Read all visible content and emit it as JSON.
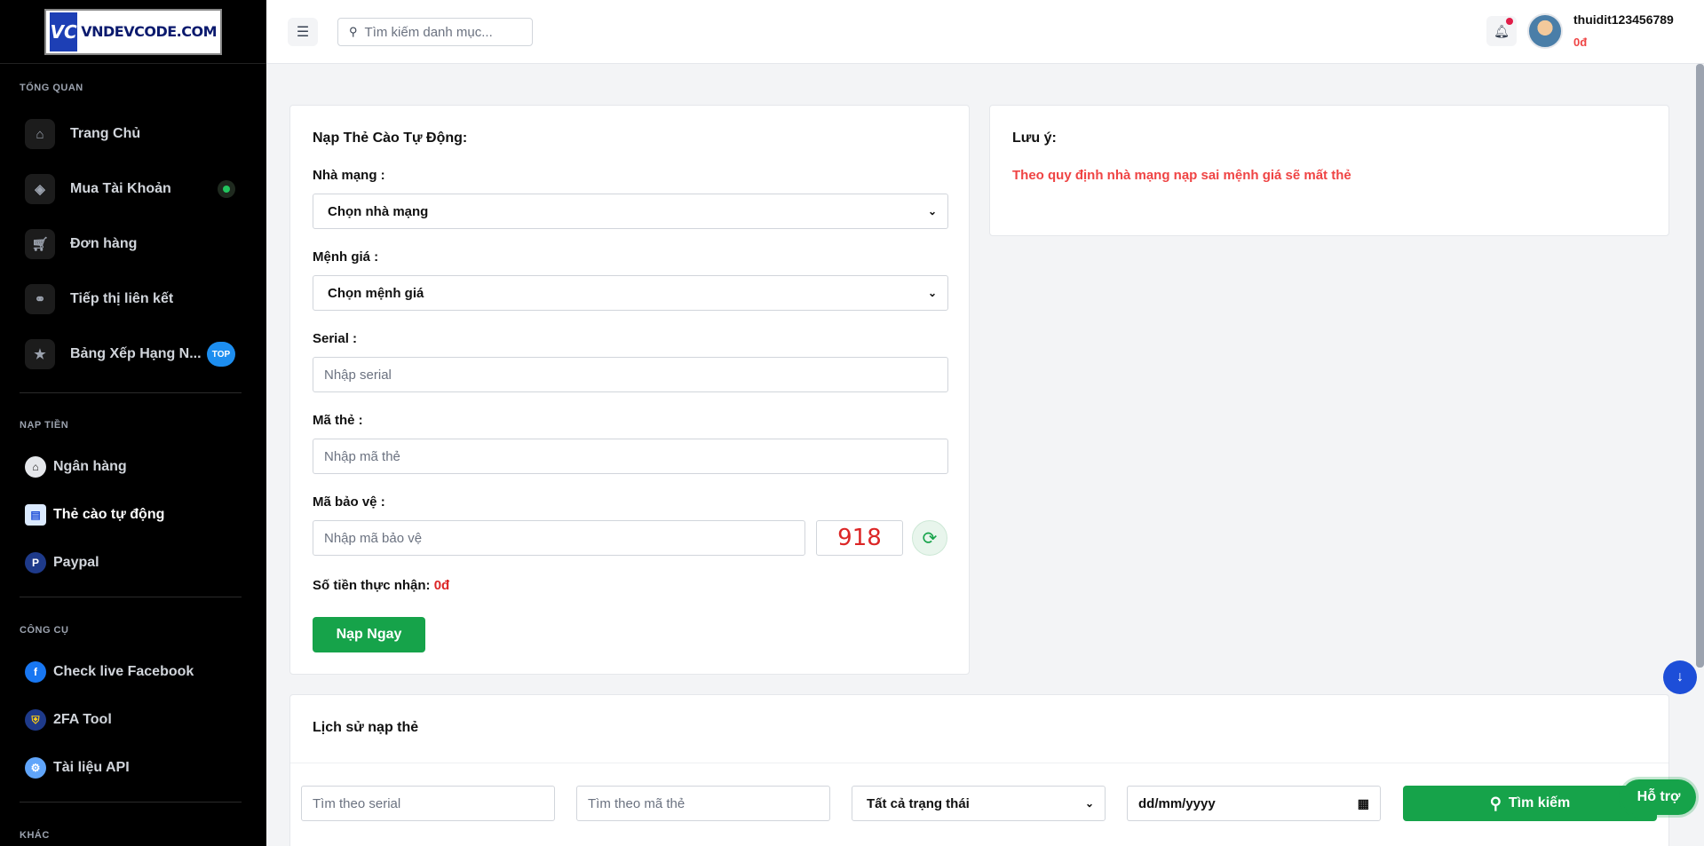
{
  "brand": {
    "logo_text": "VNDEVCODE.COM",
    "logo_mark": "VC"
  },
  "sidebar": {
    "section_overview": "TỔNG QUAN",
    "overview_items": [
      {
        "label": "Trang Chủ",
        "icon": "home-icon"
      },
      {
        "label": "Mua Tài Khoản",
        "icon": "cube-icon"
      },
      {
        "label": "Đơn hàng",
        "icon": "cart-icon"
      },
      {
        "label": "Tiếp thị liên kết",
        "icon": "share-icon"
      },
      {
        "label": "Bảng Xếp Hạng N...",
        "icon": "trophy-icon",
        "badge": "TOP"
      }
    ],
    "section_topup": "NẠP TIỀN",
    "topup_items": [
      {
        "label": "Ngân hàng",
        "icon": "bank-icon"
      },
      {
        "label": "Thẻ cào tự động",
        "icon": "card-icon",
        "active": true
      },
      {
        "label": "Paypal",
        "icon": "paypal-icon"
      }
    ],
    "section_tools": "CÔNG CỤ",
    "tool_items": [
      {
        "label": "Check live Facebook",
        "icon": "facebook-icon"
      },
      {
        "label": "2FA Tool",
        "icon": "shield-icon"
      },
      {
        "label": "Tài liệu API",
        "icon": "api-gear-icon"
      }
    ],
    "section_other": "KHÁC"
  },
  "header": {
    "search_placeholder": "Tìm kiếm danh mục...",
    "username": "thuidit123456789",
    "balance": "0đ"
  },
  "topup_form": {
    "title": "Nạp Thẻ Cào Tự Động:",
    "carrier_label": "Nhà mạng :",
    "carrier_value": "Chọn nhà mạng",
    "amount_label": "Mệnh giá :",
    "amount_value": "Chọn mệnh giá",
    "serial_label": "Serial :",
    "serial_placeholder": "Nhập serial",
    "code_label": "Mã thẻ :",
    "code_placeholder": "Nhập mã thẻ",
    "captcha_label": "Mã bảo vệ :",
    "captcha_placeholder": "Nhập mã bảo vệ",
    "captcha_value": "918",
    "received_label": "Số tiền thực nhận:",
    "received_value": "0đ",
    "submit_label": "Nạp Ngay"
  },
  "note": {
    "title": "Lưu ý:",
    "text": "Theo quy định nhà mạng nạp sai mệnh giá sẽ mất thẻ"
  },
  "history": {
    "title": "Lịch sử nạp thẻ",
    "serial_filter_placeholder": "Tìm theo serial",
    "code_filter_placeholder": "Tìm theo mã thẻ",
    "status_filter_value": "Tất cả trạng thái",
    "date_filter_value": "dd/mm/yyyy",
    "search_label": "Tìm kiếm"
  },
  "support_label": "Hỗ trợ",
  "colors": {
    "accent_green": "#16a34a",
    "danger_red": "#dc2626",
    "sidebar_bg": "#000000",
    "fab_blue": "#1d4ed8"
  }
}
